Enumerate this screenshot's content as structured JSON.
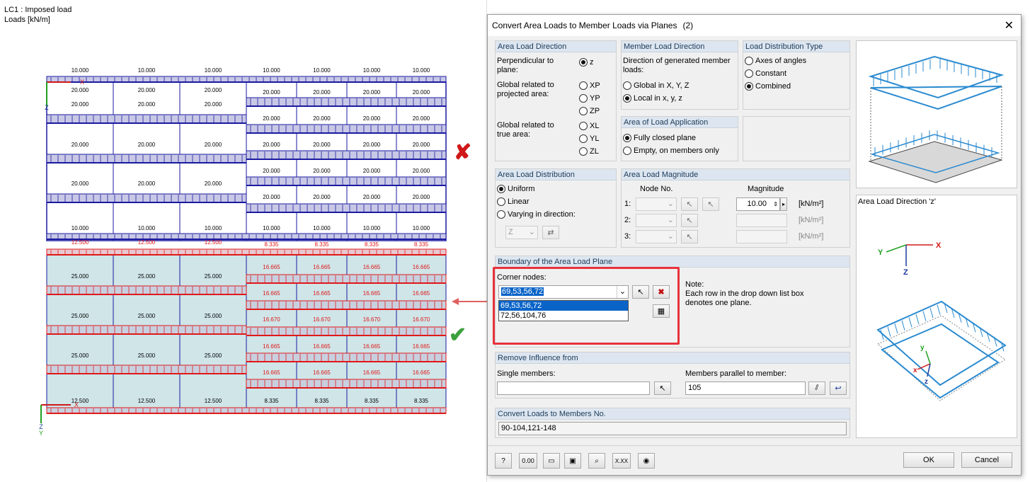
{
  "canvas": {
    "lc_title": "LC1 : Imposed load",
    "units": "Loads [kN/m]",
    "top_model": {
      "top_edge": [
        "10.000",
        "10.000",
        "10.000",
        "10.000",
        "10.000",
        "10.000",
        "10.000"
      ],
      "left_rows": [
        "20.000",
        "20.000",
        "20.000",
        "20.000"
      ],
      "right_rows": [
        "20.000",
        "20.000",
        "20.000",
        "20.000",
        "20.000",
        "20.000",
        "20.000",
        "20.000"
      ],
      "bottom_edge": [
        "10.000",
        "10.000",
        "10.000",
        "10.000",
        "10.000",
        "10.000",
        "10.000"
      ]
    },
    "bottom_model": {
      "top_edge_left": [
        "12.500",
        "12.500",
        "12.500"
      ],
      "top_edge_right": [
        "8.335",
        "8.335",
        "8.335",
        "8.335"
      ],
      "left_rows": [
        "25.000",
        "25.000",
        "25.000",
        "25.000"
      ],
      "right_rows": [
        "16.665",
        "16.665",
        "16.670",
        "16.665",
        "16.665"
      ],
      "bottom_edge_left": [
        "12.500",
        "12.500",
        "12.500"
      ],
      "bottom_edge_right": [
        "8.335",
        "8.335",
        "8.335",
        "8.335"
      ]
    },
    "axis": {
      "x": "X",
      "z": "Z",
      "y": "Y"
    },
    "cross_mark": "✘",
    "check_mark": "✔"
  },
  "dialog": {
    "title": "Convert Area Loads to Member Loads via Planes",
    "title_count": "(2)",
    "area_load_direction": {
      "title": "Area Load Direction",
      "perp_label": "Perpendicular to plane:",
      "z": "z",
      "global_proj_label": "Global related to projected area:",
      "xp": "XP",
      "yp": "YP",
      "zp": "ZP",
      "global_true_label": "Global related to true area:",
      "xl": "XL",
      "yl": "YL",
      "zl": "ZL"
    },
    "member_load_direction": {
      "title": "Member Load Direction",
      "desc": "Direction of generated member loads:",
      "global": "Global in X, Y, Z",
      "local": "Local in x, y, z"
    },
    "load_distribution_type": {
      "title": "Load Distribution Type",
      "axes": "Axes of angles",
      "constant": "Constant",
      "combined": "Combined"
    },
    "area_of_application": {
      "title": "Area of Load Application",
      "closed": "Fully closed plane",
      "empty": "Empty, on members only"
    },
    "area_load_distribution": {
      "title": "Area Load Distribution",
      "uniform": "Uniform",
      "linear": "Linear",
      "varying": "Varying in direction:",
      "dir_value": "Z"
    },
    "area_load_magnitude": {
      "title": "Area Load Magnitude",
      "node_no": "Node No.",
      "magnitude": "Magnitude",
      "row1": "1:",
      "row2": "2:",
      "row3": "3:",
      "value1": "10.00",
      "unit1": "[kN/m²]",
      "unit2": "[kN/m²]",
      "unit3": "[kN/m²]"
    },
    "boundary": {
      "title": "Boundary of the Area Load Plane",
      "corner_nodes": "Corner nodes:",
      "selected": "69,53,56,72",
      "options": [
        "69,53,56,72",
        "72,56,104,76"
      ],
      "note_title": "Note:",
      "note_text": "Each row in the drop down list box denotes one plane."
    },
    "remove_influence": {
      "title": "Remove Influence from",
      "single": "Single members:",
      "single_value": "",
      "parallel": "Members parallel to member:",
      "parallel_value": "105"
    },
    "convert_to": {
      "title": "Convert Loads to Members No.",
      "value": "90-104,121-148"
    },
    "preview_label": "Area Load Direction 'z'",
    "ok": "OK",
    "cancel": "Cancel",
    "tool_xxx": "X.XX",
    "tool_000": "0.00"
  },
  "colors": {
    "blue_load": "#1a1aa0",
    "red_load": "#e01818",
    "accent": "#0a64c8",
    "highlight": "#e8323c",
    "green": "#3ca03c"
  }
}
